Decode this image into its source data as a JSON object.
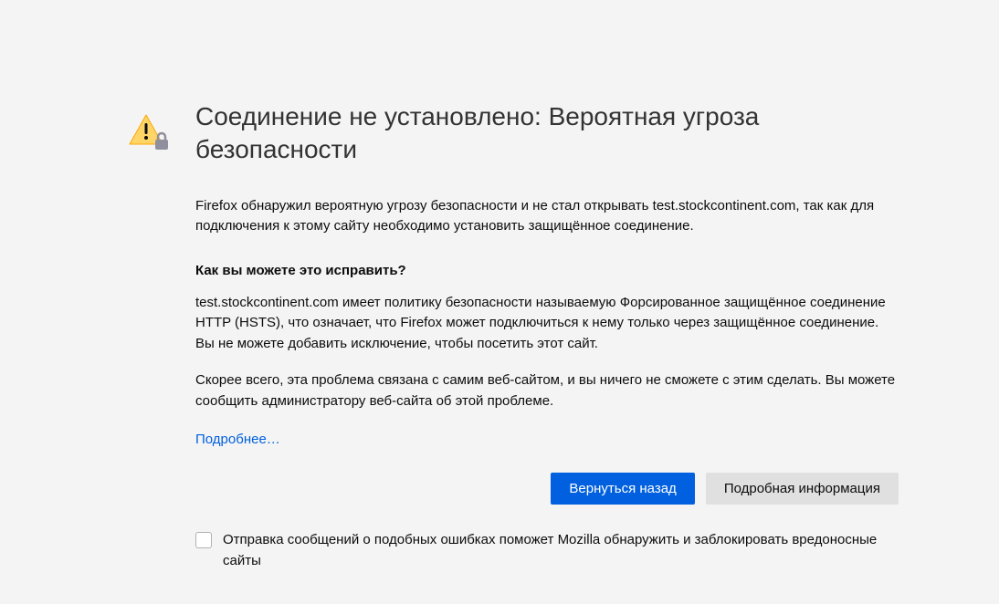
{
  "title": "Соединение не установлено: Вероятная угроза безопасности",
  "intro": "Firefox обнаружил вероятную угрозу безопасности и не стал открывать test.stockcontinent.com, так как для подключения к этому сайту необходимо установить защищённое соединение.",
  "subtitle": "Как вы можете это исправить?",
  "para1": "test.stockcontinent.com имеет политику безопасности называемую Форсированное защищённое соединение HTTP (HSTS), что означает, что Firefox может подключиться к нему только через защищённое соединение. Вы не можете добавить исключение, чтобы посетить этот сайт.",
  "para2": "Скорее всего, эта проблема связана с самим веб-сайтом, и вы ничего не сможете с этим сделать. Вы можете сообщить администратору веб-сайта об этой проблеме.",
  "learn_more": "Подробнее…",
  "buttons": {
    "go_back": "Вернуться назад",
    "more_info": "Подробная информация"
  },
  "checkbox_label": "Отправка сообщений о подобных ошибках поможет Mozilla обнаружить и заблокировать вредоносные сайты"
}
